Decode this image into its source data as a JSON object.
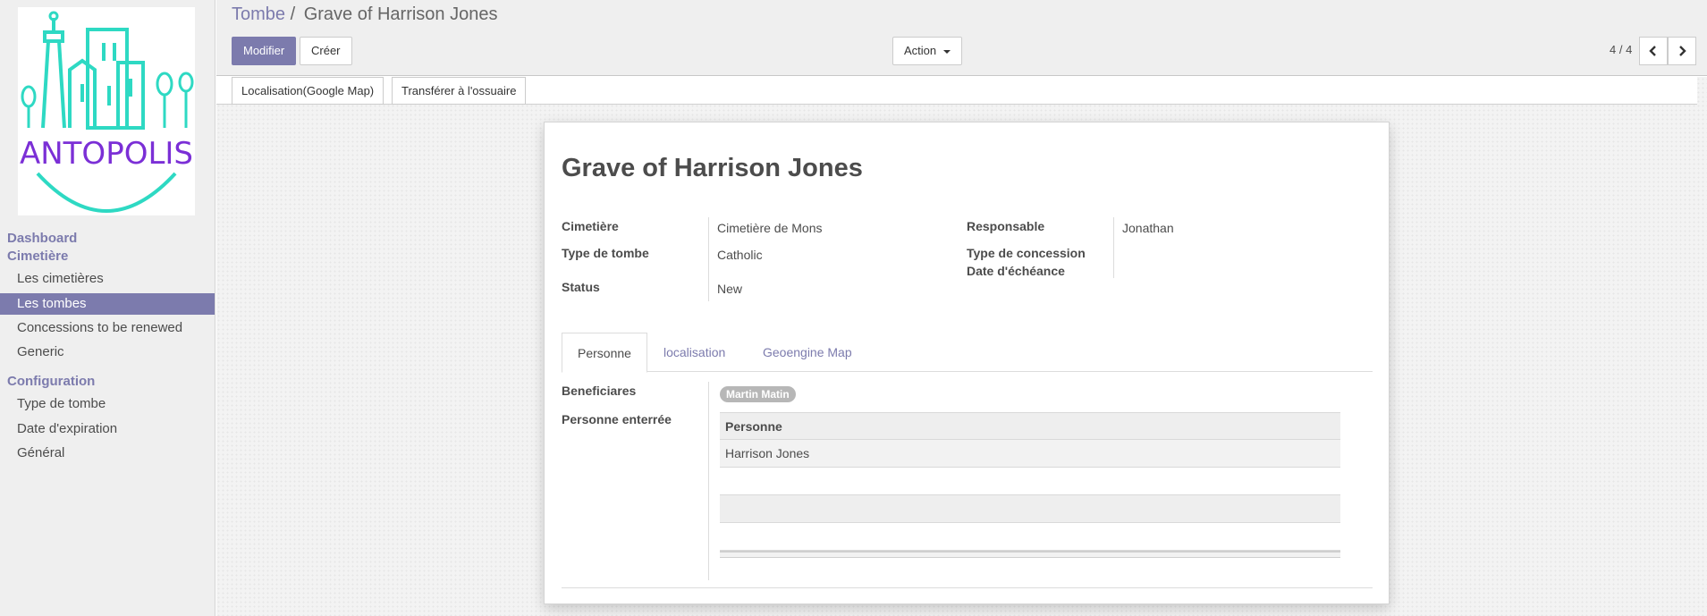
{
  "logo": {
    "text": "ANTOPOLIS",
    "teal": "#2ed9c3",
    "purple": "#7b2fd6"
  },
  "sidebar": {
    "sections": [
      {
        "label": "Dashboard"
      },
      {
        "label": "Cimetière"
      },
      {
        "label": "Configuration"
      }
    ],
    "items": [
      {
        "label": "Les cimetières"
      },
      {
        "label": "Les tombes"
      },
      {
        "label": "Concessions to be renewed"
      },
      {
        "label": "Generic"
      },
      {
        "label": "Type de tombe"
      },
      {
        "label": "Date d'expiration"
      },
      {
        "label": "Général"
      }
    ],
    "active_item": "Les tombes"
  },
  "breadcrumb": {
    "parent": "Tombe",
    "separator": "/",
    "current": "Grave of Harrison Jones"
  },
  "toolbar": {
    "edit_label": "Modifier",
    "create_label": "Créer",
    "action_label": "Action"
  },
  "pager": {
    "value": "4 / 4"
  },
  "statusbar": {
    "buttons": [
      "Localisation(Google Map)",
      "Transférer à l'ossuaire"
    ]
  },
  "form": {
    "title": "Grave of Harrison Jones",
    "fields": {
      "cimetiere": {
        "label": "Cimetière",
        "value": "Cimetière de Mons"
      },
      "type_tombe": {
        "label": "Type de tombe",
        "value": "Catholic"
      },
      "status": {
        "label": "Status",
        "value": "New"
      },
      "responsable": {
        "label": "Responsable",
        "value": "Jonathan"
      },
      "type_concession": {
        "label": "Type de concession",
        "value": ""
      },
      "date_echeance": {
        "label": "Date d'échéance",
        "value": ""
      }
    },
    "tabs": [
      "Personne",
      "localisation",
      "Geoengine Map"
    ],
    "active_tab": "Personne",
    "beneficiaires": {
      "label": "Beneficiares",
      "tags": [
        "Martin Matin"
      ]
    },
    "personne_enterree": {
      "label": "Personne enterrée",
      "column": "Personne",
      "rows": [
        "Harrison Jones"
      ]
    }
  },
  "colors": {
    "primary": "#7c7bad",
    "sidebar_bg": "#efefef",
    "active_bg": "#7c7bad"
  }
}
